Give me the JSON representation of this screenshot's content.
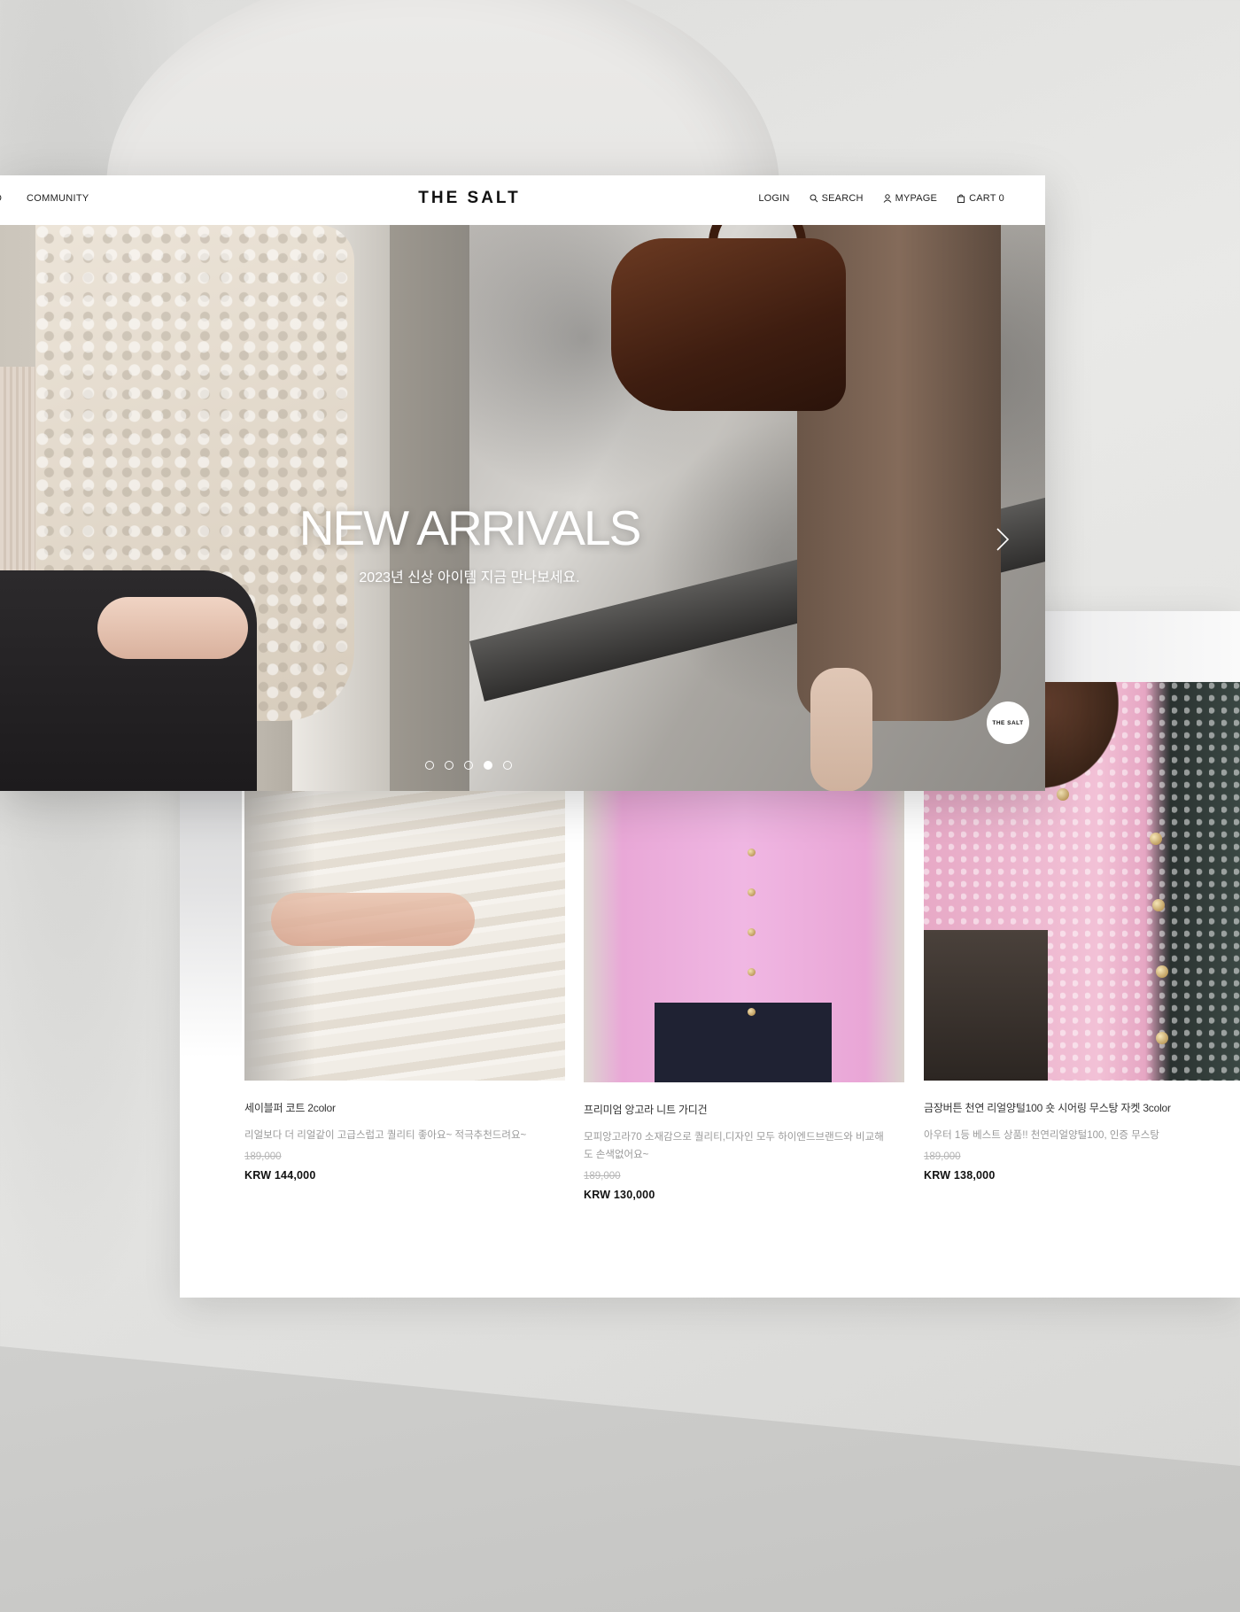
{
  "header": {
    "nav_left_partial": "D",
    "nav_community": "COMMUNITY",
    "logo": "THE SALT",
    "nav_right": {
      "login": "LOGIN",
      "search": "SEARCH",
      "mypage": "MYPAGE",
      "cart": "CART 0"
    }
  },
  "hero": {
    "title": "NEW ARRIVALS",
    "subtitle": "2023년 신상 아이템 지금 만나보세요.",
    "next_icon": "chevron-right-icon",
    "badge": "THE SALT",
    "slides": {
      "count": 5,
      "active_index": 3
    }
  },
  "products": [
    {
      "name": "세이블퍼 코트 2color",
      "description": "리얼보다 더 리얼같이 고급스럽고 퀄리티 좋아요~ 적극추천드려요~",
      "original_price": "189,000",
      "price": "KRW 144,000"
    },
    {
      "name": "프리미엄 앙고라 니트 가디건",
      "description": "모피앙고라70 소재감으로 퀄리티,디자인 모두 하이엔드브랜드와 비교해도 손색없어요~",
      "original_price": "189,000",
      "price": "KRW 130,000"
    },
    {
      "name": "금장버튼 천연 리얼양털100 숏 시어링 무스탕 자켓 3color",
      "description": "아우터 1등 베스트 상품!! 천연리얼양털100, 인증 무스탕",
      "original_price": "189,000",
      "price": "KRW 138,000"
    }
  ],
  "colors": {
    "text_primary": "#111111",
    "text_muted": "#9a9a9a",
    "strike_price": "#b5b5b5",
    "hero_text": "#ffffff"
  }
}
